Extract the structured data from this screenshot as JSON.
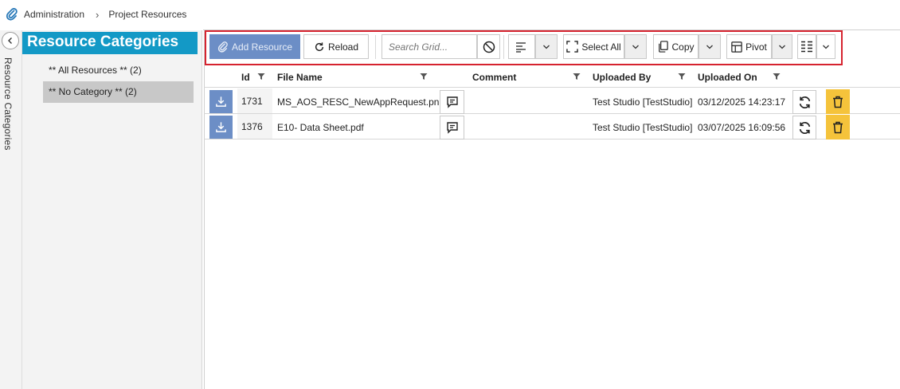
{
  "breadcrumb": {
    "root": "Administration",
    "current": "Project Resources"
  },
  "sidebar": {
    "collapsed_label": "Resource Categories"
  },
  "categories": {
    "title": "Resource Categories",
    "items": [
      {
        "label": "** All Resources ** (2)"
      },
      {
        "label": "** No Category ** (2)"
      }
    ]
  },
  "toolbar": {
    "add_label": "Add Resource",
    "reload_label": "Reload",
    "search_placeholder": "Search Grid...",
    "select_all_label": "Select All",
    "copy_label": "Copy",
    "pivot_label": "Pivot"
  },
  "grid": {
    "columns": [
      "Id",
      "File Name",
      "Comment",
      "Uploaded By",
      "Uploaded On"
    ],
    "rows": [
      {
        "id": "1731",
        "file_name": "MS_AOS_RESC_NewAppRequest.png",
        "comment": "",
        "uploaded_by": "Test Studio [TestStudio]",
        "uploaded_on": "03/12/2025 14:23:17"
      },
      {
        "id": "1376",
        "file_name": "E10- Data Sheet.pdf",
        "comment": "",
        "uploaded_by": "Test Studio [TestStudio]",
        "uploaded_on": "03/07/2025 16:09:56"
      }
    ]
  },
  "colors": {
    "accent": "#1399c6",
    "primary_button": "#6c8ec6",
    "delete": "#f5c33b",
    "highlight": "#d6232f"
  }
}
